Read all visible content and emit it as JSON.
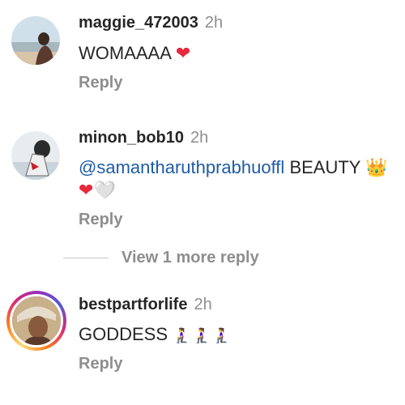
{
  "comments": [
    {
      "username": "maggie_472003",
      "time": "2h",
      "text": "WOMAAAA",
      "emoji": "❤",
      "reply_label": "Reply"
    },
    {
      "username": "minon_bob10",
      "time": "2h",
      "mention": "@samantharuthprabhuoffl",
      "text": "BEAUTY",
      "emoji_crown": "👑",
      "emoji_heart_red": "❤",
      "emoji_heart_white": "🤍",
      "reply_label": "Reply"
    },
    {
      "username": "bestpartforlife",
      "time": "2h",
      "text": "GODDESS",
      "emoji": "🧎‍♀️🧎‍♀️🧎‍♀️",
      "reply_label": "Reply"
    }
  ],
  "view_more_label": "View 1 more reply",
  "colors": {
    "mention": "#1e5ba8",
    "secondary_text": "#8e8e8e",
    "heart": "#e8283c"
  }
}
